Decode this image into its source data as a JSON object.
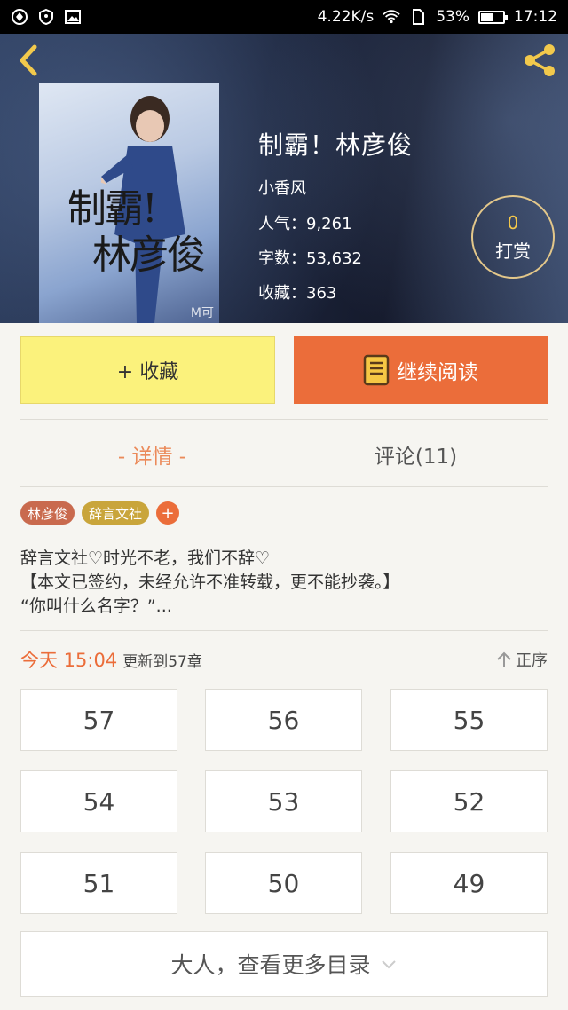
{
  "status_bar": {
    "speed": "4.22K/s",
    "battery": "53%",
    "battery_level": 0.53,
    "time": "17:12"
  },
  "book": {
    "cover_title_line1": "制霸!",
    "cover_title_line2": "林彦俊",
    "cover_watermark": "M可",
    "title": "制霸！林彦俊",
    "author": "小香风",
    "popularity": "人气：9,261",
    "word_count": "字数：53,632",
    "favorites": "收藏：363"
  },
  "reward": {
    "count": "0",
    "label": "打赏"
  },
  "actions": {
    "collect": "+ 收藏",
    "continue_read": "继续阅读"
  },
  "tabs": [
    {
      "label": "- 详情 -"
    },
    {
      "label": "评论(11)"
    }
  ],
  "tags": [
    "林彦俊",
    "辞言文社"
  ],
  "tag_add": "+",
  "description": [
    "辞言文社♡时光不老，我们不辞♡",
    "【本文已签约，未经允许不准转载，更不能抄袭。】",
    "“你叫什么名字？”..."
  ],
  "update": {
    "date": "今天 15:04",
    "text": "更新到57章"
  },
  "sort_label": "正序",
  "chapters": [
    "57",
    "56",
    "55",
    "54",
    "53",
    "52",
    "51",
    "50",
    "49"
  ],
  "more_label": "大人，查看更多目录",
  "colors": {
    "accent": "#eb6d3a",
    "collect": "#fbf27c",
    "tab_active": "#eb8a5a"
  }
}
